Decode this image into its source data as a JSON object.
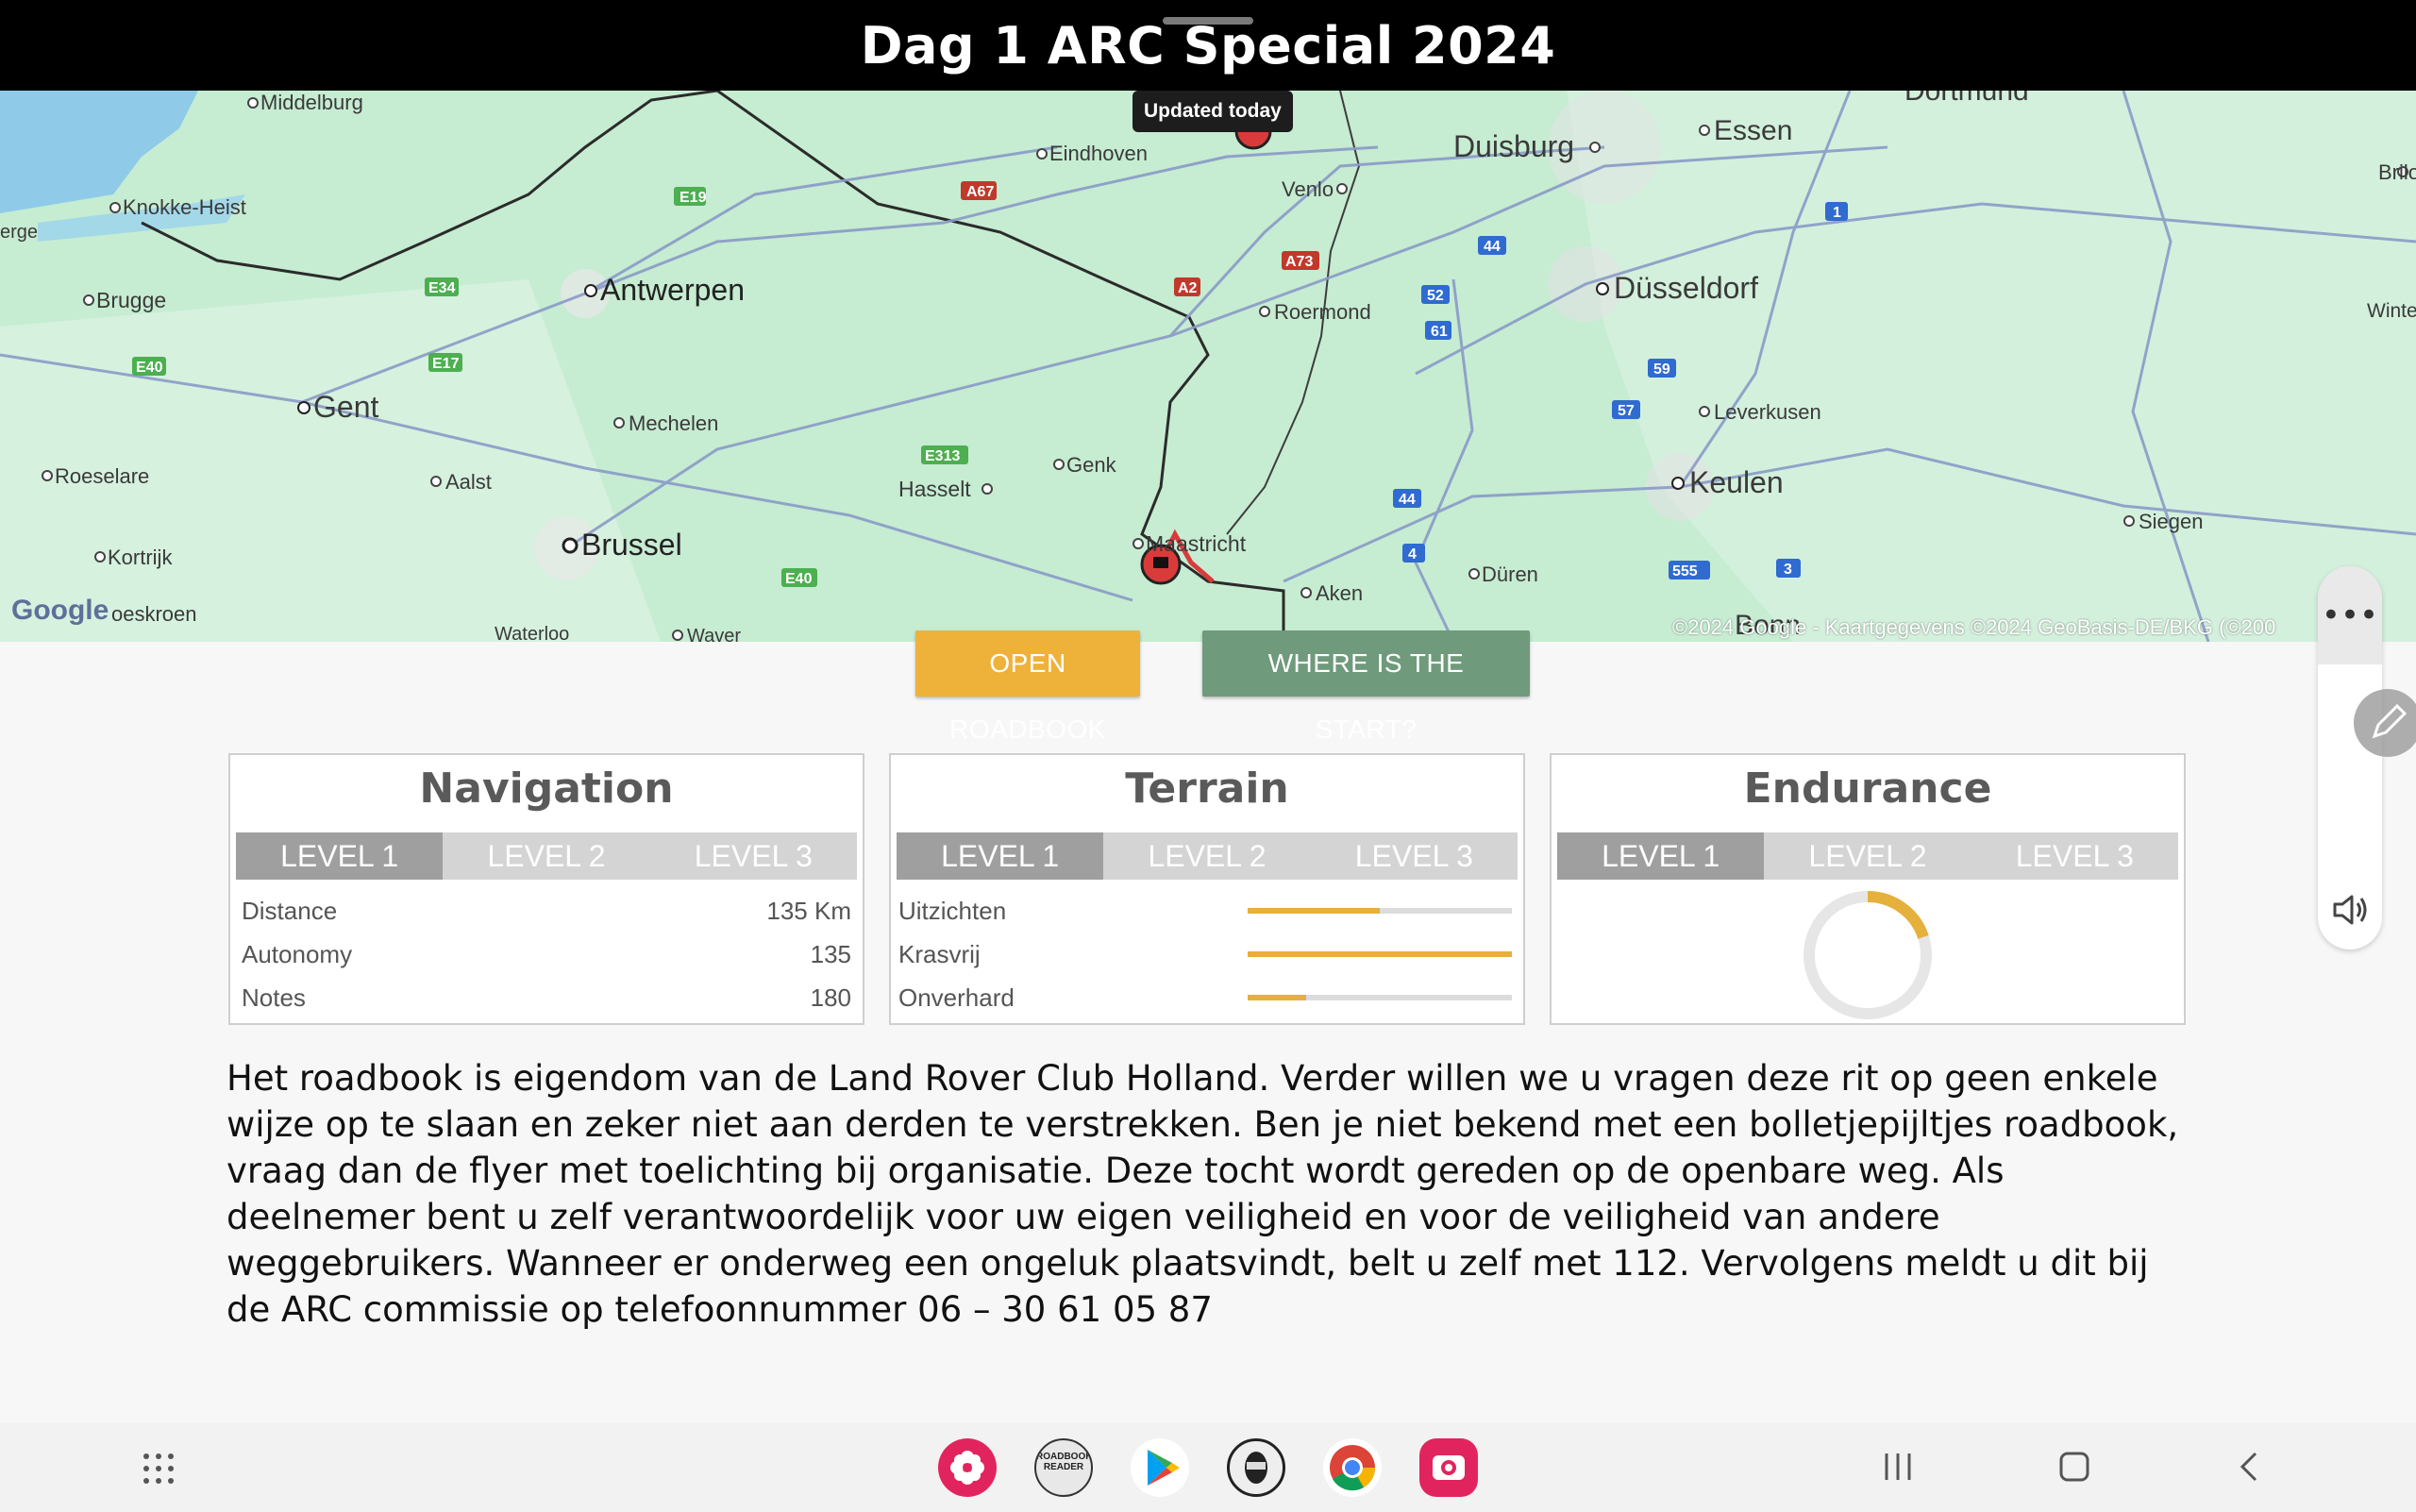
{
  "header": {
    "title": "Dag 1 ARC Special 2024"
  },
  "map": {
    "updated_badge": "Updated today",
    "google_logo": "Google",
    "copyright": "©2024 Google - Kaartgegevens ©2024 GeoBasis-DE/BKG (©200",
    "cities": [
      "Middelburg",
      "Eindhoven",
      "Dortmund",
      "Essen",
      "Duisburg",
      "Knokke-Heist",
      "Venlo",
      "Brilo",
      "erge",
      "Antwerpen",
      "Roermond",
      "Düsseldorf",
      "Brugge",
      "Winter",
      "Gent",
      "Mechelen",
      "Leverkusen",
      "Genk",
      "Roeselare",
      "Aalst",
      "Hasselt",
      "Keulen",
      "Siegen",
      "Brussel",
      "Maastricht",
      "Kortrijk",
      "Düren",
      "Aken",
      "oeskroen",
      "Waterloo",
      "Waver",
      "Bonn"
    ],
    "roads": [
      "E19",
      "A67",
      "E34",
      "A2",
      "A73",
      "44",
      "1",
      "52",
      "61",
      "E40",
      "E17",
      "59",
      "57",
      "E313",
      "44",
      "4",
      "E40",
      "555",
      "3"
    ]
  },
  "buttons": {
    "open_roadbook": "OPEN ROADBOOK",
    "where_start": "WHERE IS THE START?"
  },
  "cards": {
    "navigation": {
      "title": "Navigation",
      "levels": [
        "LEVEL 1",
        "LEVEL 2",
        "LEVEL 3"
      ],
      "active_level": 1,
      "rows": [
        {
          "label": "Distance",
          "value": "135 Km"
        },
        {
          "label": "Autonomy",
          "value": "135"
        },
        {
          "label": "Notes",
          "value": "180"
        }
      ]
    },
    "terrain": {
      "title": "Terrain",
      "levels": [
        "LEVEL 1",
        "LEVEL 2",
        "LEVEL 3"
      ],
      "active_level": 1,
      "rows": [
        {
          "label": "Uitzichten",
          "fraction": 0.5
        },
        {
          "label": "Krasvrij",
          "fraction": 1.0
        },
        {
          "label": "Onverhard",
          "fraction": 0.22
        }
      ]
    },
    "endurance": {
      "title": "Endurance",
      "levels": [
        "LEVEL 1",
        "LEVEL 2",
        "LEVEL 3"
      ],
      "active_level": 1,
      "donut_fraction": 0.2
    }
  },
  "disclaimer": "Het roadbook is eigendom van de Land Rover Club Holland. Verder willen we u vragen deze rit op geen enkele wijze op te slaan en zeker niet aan derden te verstrekken. Ben je niet bekend met  een bolletjepijltjes roadbook, vraag dan de flyer met toelichting bij organisatie. Deze tocht wordt gereden op de openbare weg. Als deelnemer bent u zelf verantwoordelijk voor uw eigen veiligheid en voor de veiligheid van andere weggebruikers. Wanneer er onderweg een ongeluk plaatsvindt, belt u zelf met 112. Vervolgens meldt u dit bij de ARC commissie op telefoonnummer 06 – 30 61 05 87",
  "dock": {
    "apps": [
      "flower-app-icon",
      "roadbook-reader-icon",
      "play-store-icon",
      "gear-helmet-icon",
      "chrome-icon",
      "camera-app-icon"
    ],
    "roadbook_reader_label": "ROADBOOK READER"
  },
  "colors": {
    "accent_yellow": "#eeb23a",
    "accent_green": "#6f9a7c",
    "level_active": "#9f9f9f",
    "level_inactive": "#d4d4d4"
  }
}
